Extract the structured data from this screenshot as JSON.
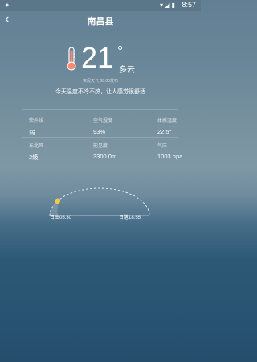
{
  "status_bar": {
    "left_badge": "●",
    "time": "8:57"
  },
  "header": {
    "title": "南昌县"
  },
  "current": {
    "temperature": "21",
    "degree_symbol": "°",
    "condition": "多云",
    "update_text": "实况天气 08:00发布",
    "summary": "今天温度不冷不热，让人感觉很舒适"
  },
  "metrics": [
    {
      "label": "紫外线",
      "value": "弱"
    },
    {
      "label": "空气湿度",
      "value": "93%"
    },
    {
      "label": "体感温度",
      "value": "22.5°"
    },
    {
      "label": "东北风",
      "value": "2级"
    },
    {
      "label": "能见度",
      "value": "3300.0m"
    },
    {
      "label": "气压",
      "value": "1003 hpa"
    }
  ],
  "sun": {
    "sunrise": "日出05:30",
    "sunset": "日落18:55",
    "progress": 0.18
  },
  "colors": {
    "sun": "#f2c84b",
    "arc": "#ffffff",
    "thermo_fill": "#ff8a70"
  }
}
